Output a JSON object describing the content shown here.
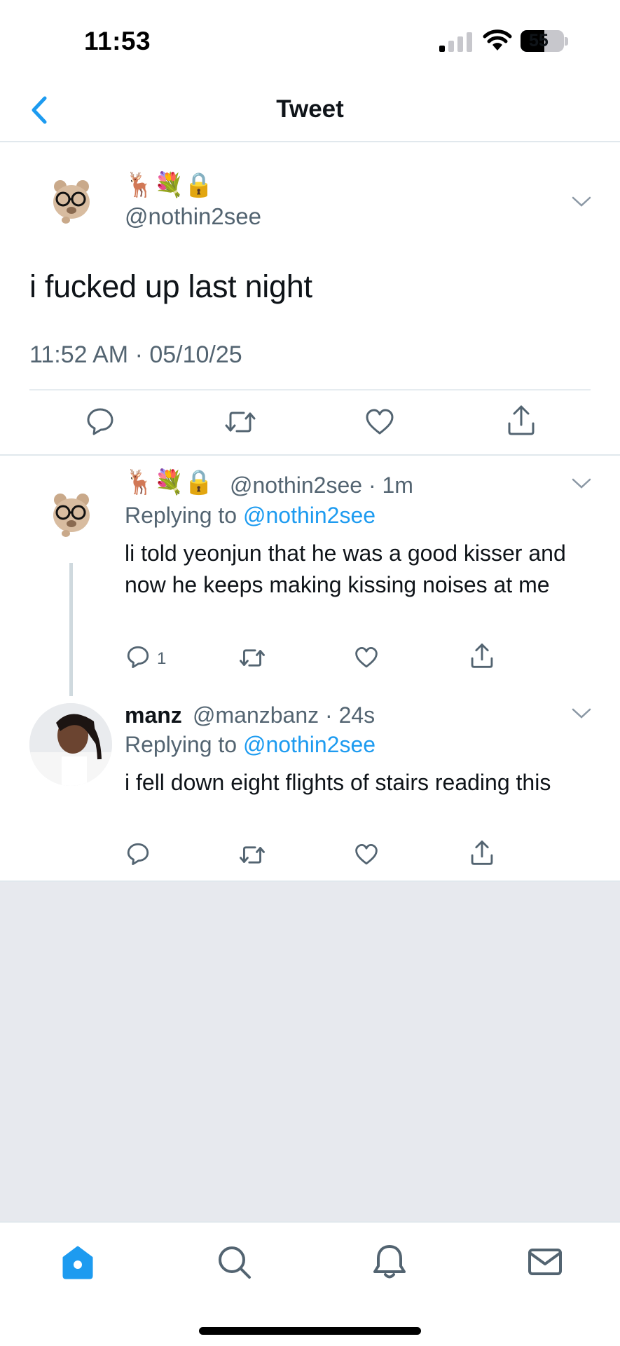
{
  "status_bar": {
    "time": "11:53",
    "battery": "55",
    "battery_level_percent": 55
  },
  "nav": {
    "title": "Tweet"
  },
  "main_tweet": {
    "display_name": "🦌💐🔒",
    "handle": "@nothin2see",
    "text": "i fucked up last night",
    "timestamp": "11:52 AM · 05/10/25"
  },
  "replies": [
    {
      "display_name": "🦌💐🔒",
      "handle_time": "@nothin2see · 1m",
      "replying_prefix": "Replying to ",
      "replying_to": "@nothin2see",
      "text": "li told yeonjun that he was a good kisser and now he keeps making kissing noises at me",
      "reply_count": "1"
    },
    {
      "display_name": "manz",
      "handle_time": "@manzbanz · 24s",
      "replying_prefix": "Replying to ",
      "replying_to": "@nothin2see",
      "text": "i fell down eight flights of stairs reading this",
      "reply_count": ""
    }
  ],
  "tabs": [
    "home",
    "search",
    "notifications",
    "messages"
  ],
  "colors": {
    "accent": "#1d9bf0",
    "secondary_text": "#536471",
    "empty_background": "#e7e9ee"
  },
  "icons": [
    "back-chevron-icon",
    "chevron-down-icon",
    "reply-icon",
    "retweet-icon",
    "like-icon",
    "share-icon",
    "home-icon",
    "search-icon",
    "bell-icon",
    "mail-icon"
  ]
}
